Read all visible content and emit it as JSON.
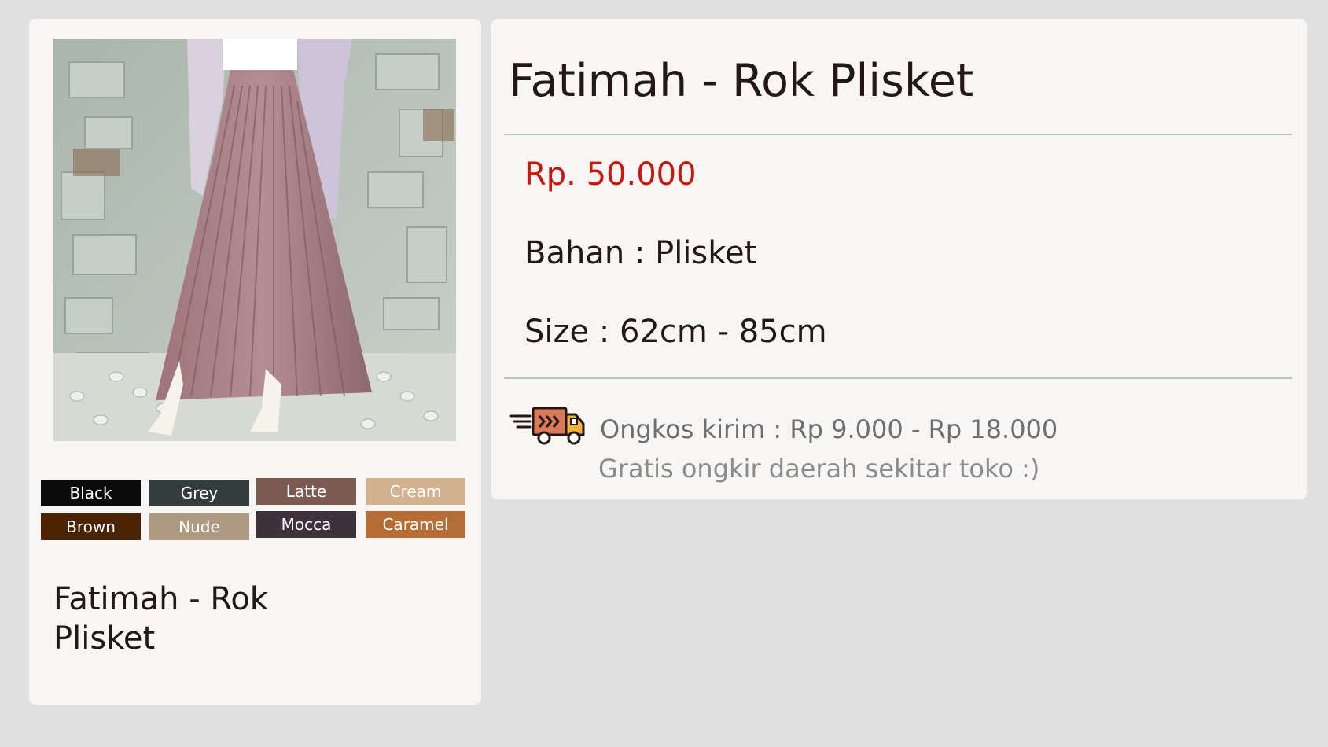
{
  "product_card": {
    "image_alt": "Fatimah - Rok Plisket",
    "title": "Fatimah - Rok Plisket",
    "colors": [
      {
        "label": "Black",
        "hex": "#0b0b0b"
      },
      {
        "label": "Grey",
        "hex": "#343d3e"
      },
      {
        "label": "Latte",
        "hex": "#7b5b51"
      },
      {
        "label": "Cream",
        "hex": "#d2b291"
      },
      {
        "label": "Brown",
        "hex": "#4b2305"
      },
      {
        "label": "Nude",
        "hex": "#ae9982"
      },
      {
        "label": "Mocca",
        "hex": "#3e313a"
      },
      {
        "label": "Caramel",
        "hex": "#b56c35"
      }
    ]
  },
  "detail": {
    "title": "Fatimah - Rok Plisket",
    "price": "Rp. 50.000",
    "material": "Bahan : Plisket",
    "size": "Size : 62cm - 85cm",
    "shipping_cost": "Ongkos kirim : Rp 9.000 - Rp 18.000",
    "shipping_note": "Gratis ongkir daerah sekitar toko :)",
    "shipping_icon": "delivery-truck-icon"
  },
  "theme": {
    "background": "#e0e0e0",
    "card": "#f7f6f5",
    "price_color": "#c8170e",
    "divider": "#b5c3c1"
  }
}
